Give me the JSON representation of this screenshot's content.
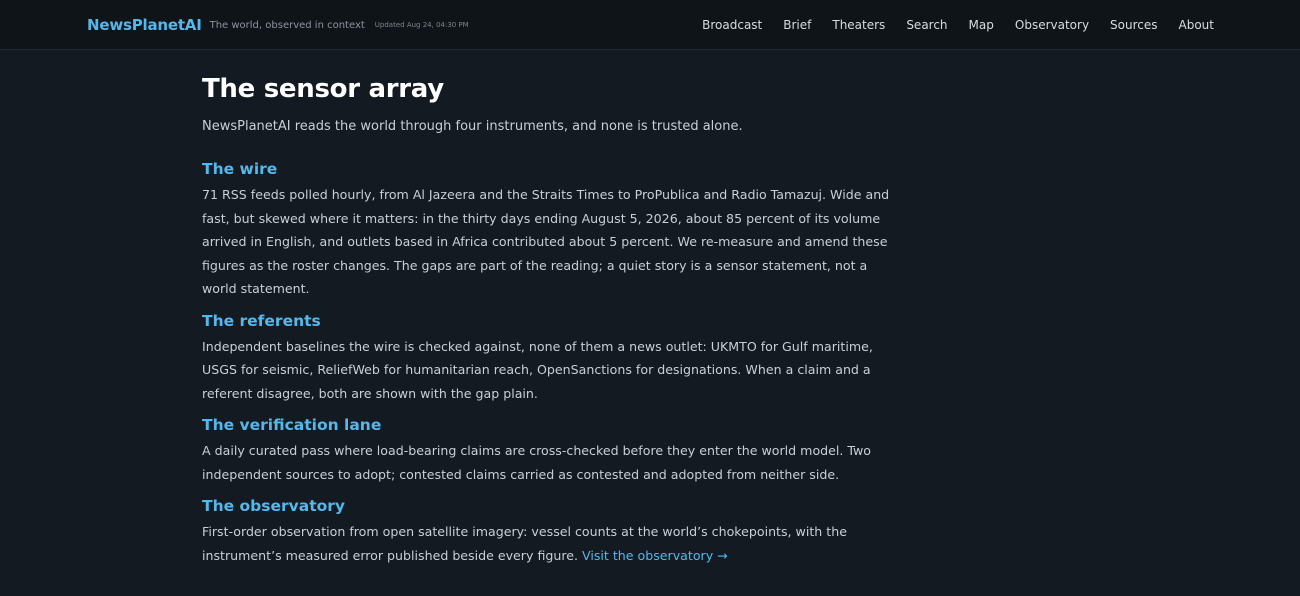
{
  "header": {
    "brand": "NewsPlanetAI",
    "tagline": "The world, observed in context",
    "updated": "Updated Aug 24, 04:30 PM",
    "nav": [
      "Broadcast",
      "Brief",
      "Theaters",
      "Search",
      "Map",
      "Observatory",
      "Sources",
      "About"
    ]
  },
  "page": {
    "title": "The sensor array",
    "lead": "NewsPlanetAI reads the world through four instruments, and none is trusted alone."
  },
  "sections": [
    {
      "heading": "The wire",
      "body": "71 RSS feeds polled hourly, from Al Jazeera and the Straits Times to ProPublica and Radio Tamazuj. Wide and fast, but skewed where it matters: in the thirty days ending August 5, 2026, about 85 percent of its volume arrived in English, and outlets based in Africa contributed about 5 percent. We re-measure and amend these figures as the roster changes. The gaps are part of the reading; a quiet story is a sensor statement, not a world statement."
    },
    {
      "heading": "The referents",
      "body": "Independent baselines the wire is checked against, none of them a news outlet: UKMTO for Gulf maritime, USGS for seismic, ReliefWeb for humanitarian reach, OpenSanctions for designations. When a claim and a referent disagree, both are shown with the gap plain."
    },
    {
      "heading": "The verification lane",
      "body": "A daily curated pass where load-bearing claims are cross-checked before they enter the world model. Two independent sources to adopt; contested claims carried as contested and adopted from neither side."
    },
    {
      "heading": "The observatory",
      "body": "First-order observation from open satellite imagery: vessel counts at the world’s chokepoints, with the instrument’s measured error published beside every figure.",
      "link": "Visit the observatory →"
    }
  ]
}
